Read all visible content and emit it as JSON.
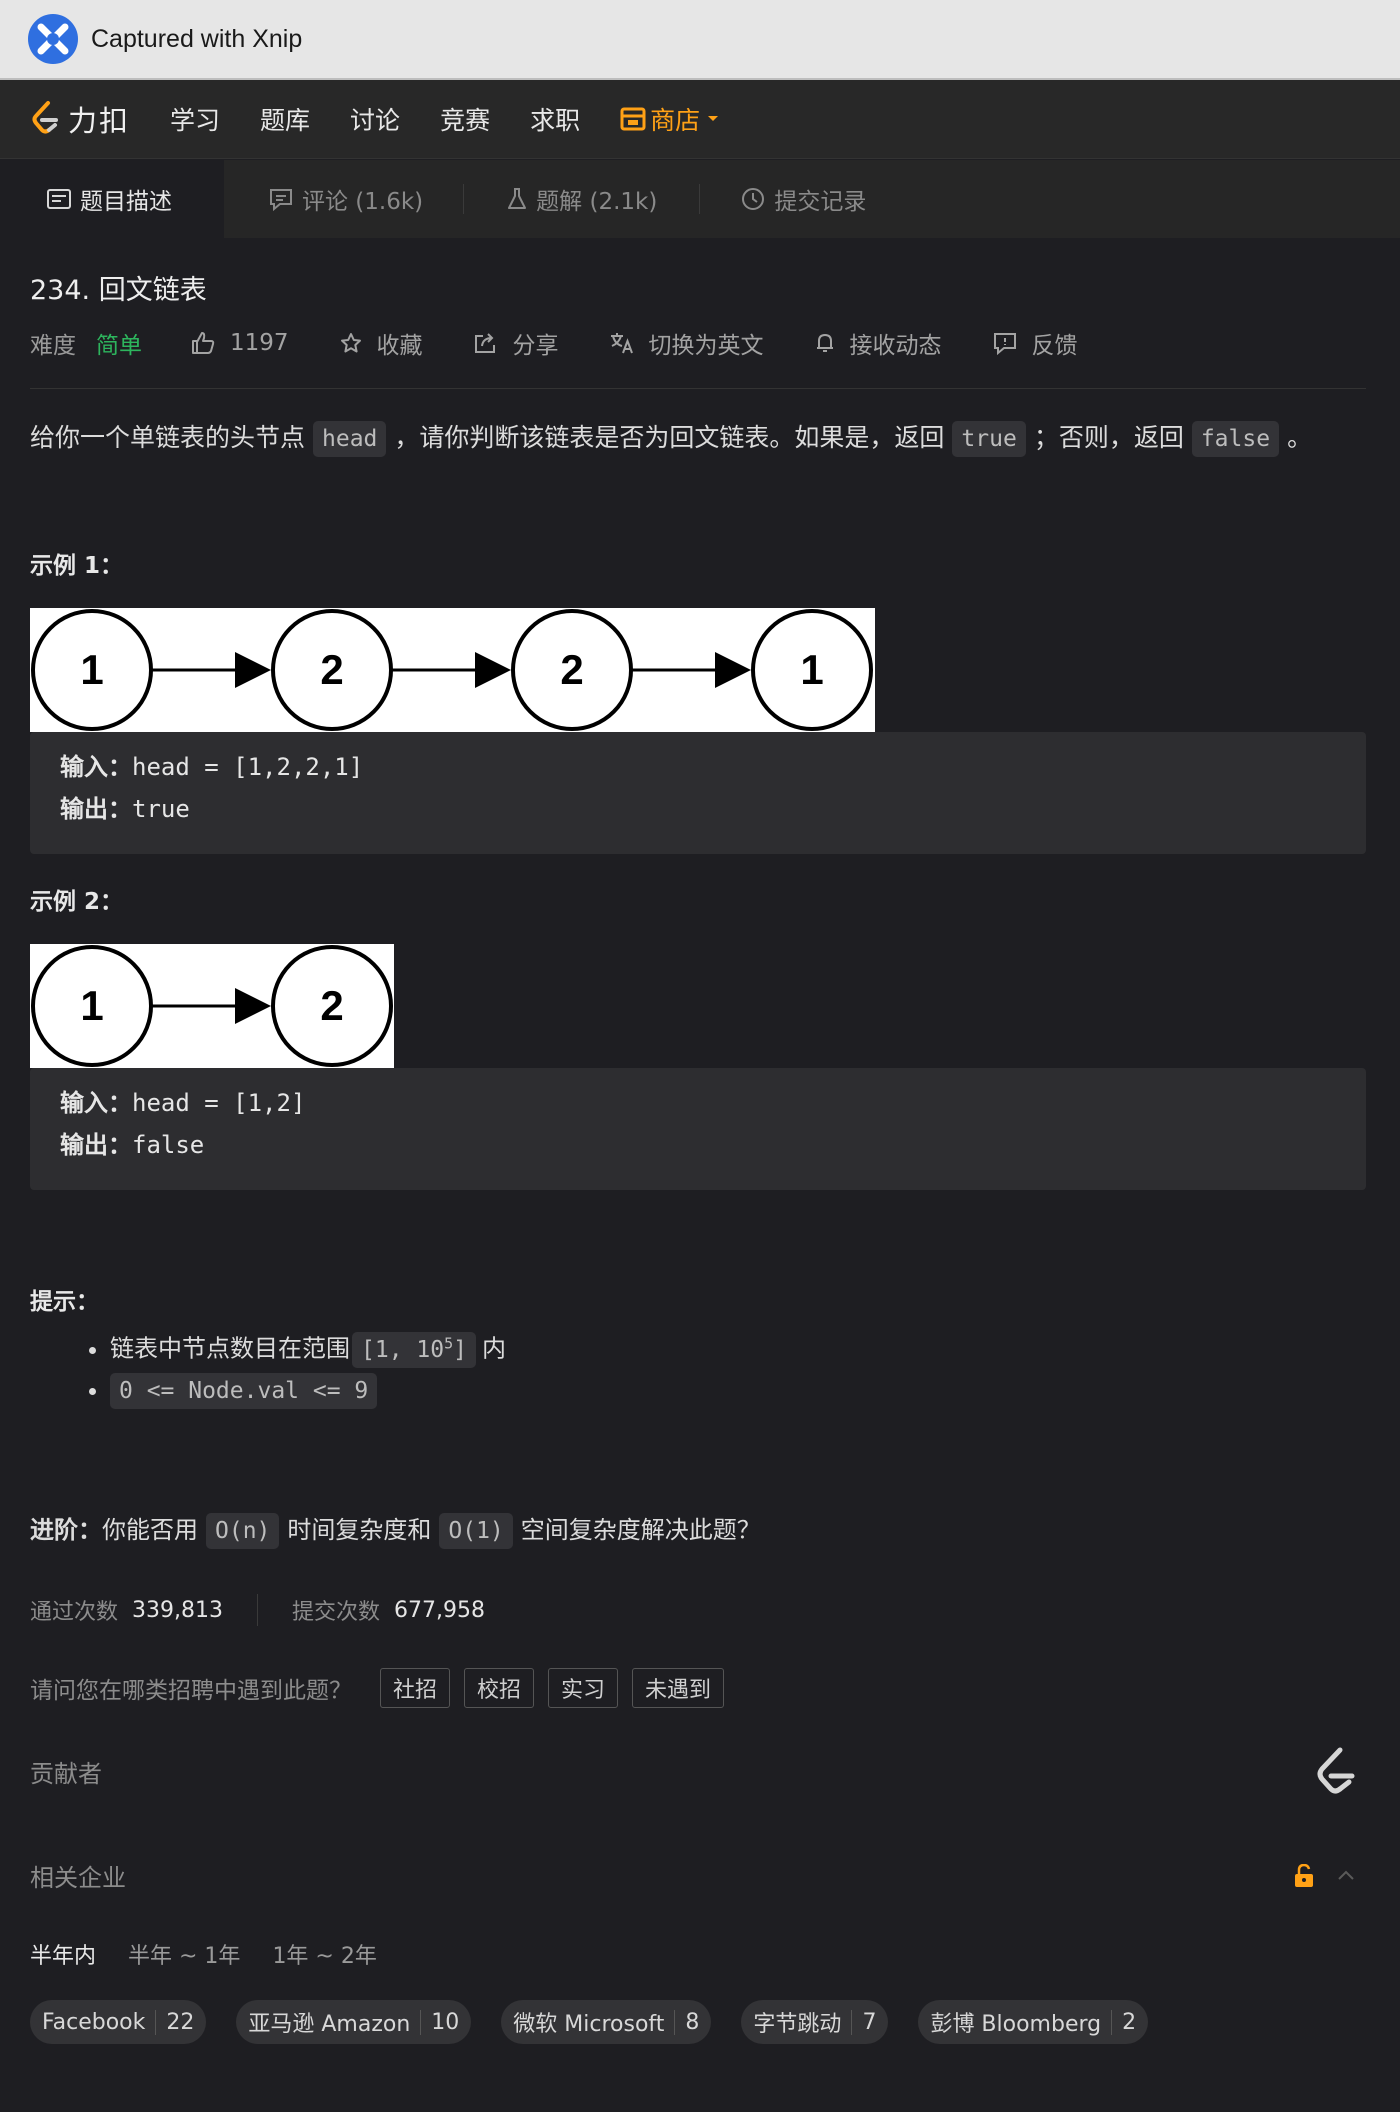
{
  "window": {
    "title": "Captured with Xnip"
  },
  "nav": {
    "brand": "力扣",
    "items": [
      "学习",
      "题库",
      "讨论",
      "竞赛",
      "求职"
    ],
    "store": "商店",
    "accent": "#ffa116"
  },
  "tabs": [
    {
      "label": "题目描述",
      "icon": "description-icon"
    },
    {
      "label": "评论 (1.6k)",
      "icon": "comment-icon"
    },
    {
      "label": "题解 (2.1k)",
      "icon": "flask-icon"
    },
    {
      "label": "提交记录",
      "icon": "clock-icon"
    }
  ],
  "problem": {
    "title": "234. 回文链表",
    "difficulty_label": "难度",
    "difficulty": "简单",
    "likes": "1197",
    "favorite": "收藏",
    "share": "分享",
    "translate": "切换为英文",
    "subscribe": "接收动态",
    "feedback": "反馈",
    "desc_1": "给你一个单链表的头节点",
    "desc_code_1": "head",
    "desc_2": "，请你判断该链表是否为回文链表。如果是，返回",
    "desc_code_2": "true",
    "desc_3": "；否则，返回",
    "desc_code_3": "false",
    "desc_4": "。"
  },
  "examples": [
    {
      "heading": "示例 1：",
      "nodes": [
        "1",
        "2",
        "2",
        "1"
      ],
      "input_label": "输入：",
      "input": "head = [1,2,2,1]",
      "output_label": "输出：",
      "output": "true"
    },
    {
      "heading": "示例 2：",
      "nodes": [
        "1",
        "2"
      ],
      "input_label": "输入：",
      "input": "head = [1,2]",
      "output_label": "输出：",
      "output": "false"
    }
  ],
  "hints": {
    "heading": "提示：",
    "item1_text": "链表中节点数目在范围",
    "item1_code_a": "[1, 10",
    "item1_code_sup": "5",
    "item1_code_b": "]",
    "item1_tail": "内",
    "item2_code": "0 <= Node.val <= 9"
  },
  "advanced": {
    "label": "进阶：",
    "text_1": "你能否用",
    "code_1": "O(n)",
    "text_2": "时间复杂度和",
    "code_2": "O(1)",
    "text_3": "空间复杂度解决此题？"
  },
  "stats": {
    "accepted_label": "通过次数",
    "accepted": "339,813",
    "submitted_label": "提交次数",
    "submitted": "677,958"
  },
  "survey": {
    "question": "请问您在哪类招聘中遇到此题？",
    "options": [
      "社招",
      "校招",
      "实习",
      "未遇到"
    ]
  },
  "contributors": {
    "label": "贡献者"
  },
  "related": {
    "label": "相关企业",
    "periods": [
      "半年内",
      "半年 ~ 1年",
      "1年 ~ 2年"
    ],
    "companies": [
      {
        "name": "Facebook",
        "count": "22"
      },
      {
        "name": "亚马逊 Amazon",
        "count": "10"
      },
      {
        "name": "微软 Microsoft",
        "count": "8"
      },
      {
        "name": "字节跳动",
        "count": "7"
      },
      {
        "name": "彭博 Bloomberg",
        "count": "2"
      }
    ]
  }
}
